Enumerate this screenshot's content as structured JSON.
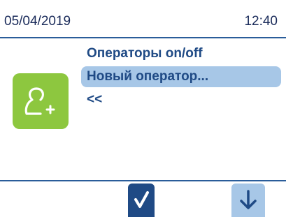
{
  "status": {
    "date": "05/04/2019",
    "time": "12:40"
  },
  "icon": {
    "name": "add-user-icon",
    "color": "#8dc73f"
  },
  "menu": {
    "items": [
      {
        "label": "Операторы on/off",
        "selected": false
      },
      {
        "label": "Новый оператор...",
        "selected": true
      },
      {
        "label": "<<",
        "selected": false
      }
    ]
  },
  "buttons": {
    "ok_icon": "check-icon",
    "down_icon": "arrow-down-icon"
  },
  "colors": {
    "accent": "#1f4a85",
    "selection": "#a7c7e7",
    "icon_bg": "#8dc73f"
  }
}
